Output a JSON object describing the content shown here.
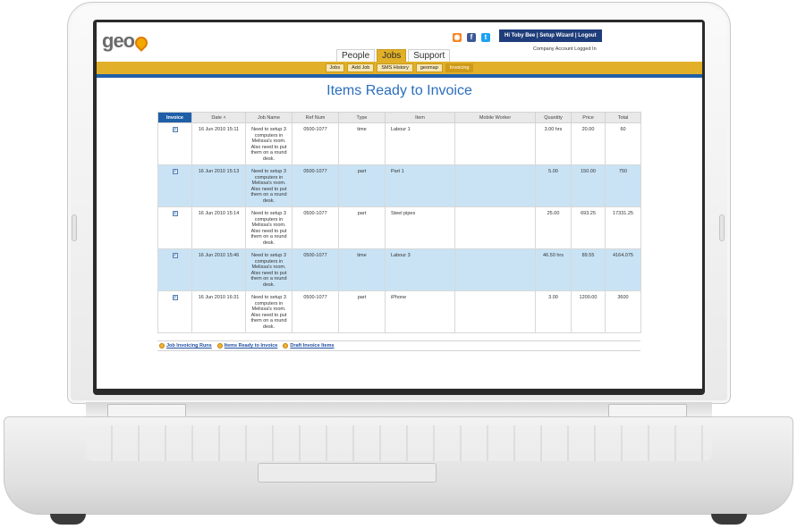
{
  "app": {
    "logo_text": "geo",
    "userbar": {
      "greeting": "Hi Toby Bee",
      "setup": "Setup Wizard",
      "logout": "Logout",
      "sep": "|"
    },
    "account_status": "Company Account Logged In",
    "social_icons": [
      "rss-icon",
      "facebook-icon",
      "twitter-icon"
    ]
  },
  "tabs": [
    {
      "label": "People",
      "active": false
    },
    {
      "label": "Jobs",
      "active": true
    },
    {
      "label": "Support",
      "active": false
    }
  ],
  "subnav": [
    {
      "label": "Jobs",
      "active": false
    },
    {
      "label": "Add Job",
      "active": false
    },
    {
      "label": "SMS History",
      "active": false
    },
    {
      "label": "geomap",
      "active": false
    },
    {
      "label": "Invoicing",
      "active": true
    }
  ],
  "page_title": "Items Ready to Invoice",
  "table": {
    "columns": [
      "Invoice",
      "Date",
      "Job Name",
      "Ref Num",
      "Type",
      "Item",
      "Mobile Worker",
      "Quantity",
      "Price",
      "Total"
    ],
    "sort_indicator": "˄",
    "rows": [
      {
        "checked": true,
        "date": "16 Jun 2010 15:11",
        "job_name": "Need to setup 3 computers in Melissa's room. Also need to put them on a round desk.",
        "ref": "0500-1077",
        "type": "time",
        "item": "Labour 1",
        "worker": "",
        "qty": "3.00 hrs",
        "price": "20.00",
        "total": "60"
      },
      {
        "checked": true,
        "date": "16 Jun 2010 15:13",
        "job_name": "Need to setup 3 computers in Melissa's room. Also need to put them on a round desk.",
        "ref": "0500-1077",
        "type": "part",
        "item": "Part 1",
        "worker": "",
        "qty": "5.00",
        "price": "150.00",
        "total": "750"
      },
      {
        "checked": true,
        "date": "16 Jun 2010 15:14",
        "job_name": "Need to setup 3 computers in Melissa's room. Also need to put them on a round desk.",
        "ref": "0500-1077",
        "type": "part",
        "item": "Steel pipes",
        "worker": "",
        "qty": "25.00",
        "price": "693.25",
        "total": "17331.25"
      },
      {
        "checked": true,
        "date": "16 Jun 2010 15:46",
        "job_name": "Need to setup 3 computers in Melissa's room. Also need to put them on a round desk.",
        "ref": "0500-1077",
        "type": "time",
        "item": "Labour 3",
        "worker": "",
        "qty": "46.50 hrs",
        "price": "89.55",
        "total": "4164.075"
      },
      {
        "checked": true,
        "date": "16 Jun 2010 16:31",
        "job_name": "Need to setup 3 computers in Melissa's room. Also need to put them on a round desk.",
        "ref": "0500-1077",
        "type": "part",
        "item": "iPhone",
        "worker": "",
        "qty": "3.00",
        "price": "1200.00",
        "total": "3600"
      }
    ]
  },
  "footer_links": [
    "Job Invoicing Runs",
    "Items Ready to Invoice",
    "Draft Invoice Items"
  ],
  "colors": {
    "accent_blue": "#1f5fa8",
    "title_blue": "#2a6ebd",
    "nav_gold": "#e2b028",
    "row_highlight": "#c9e3f5"
  }
}
